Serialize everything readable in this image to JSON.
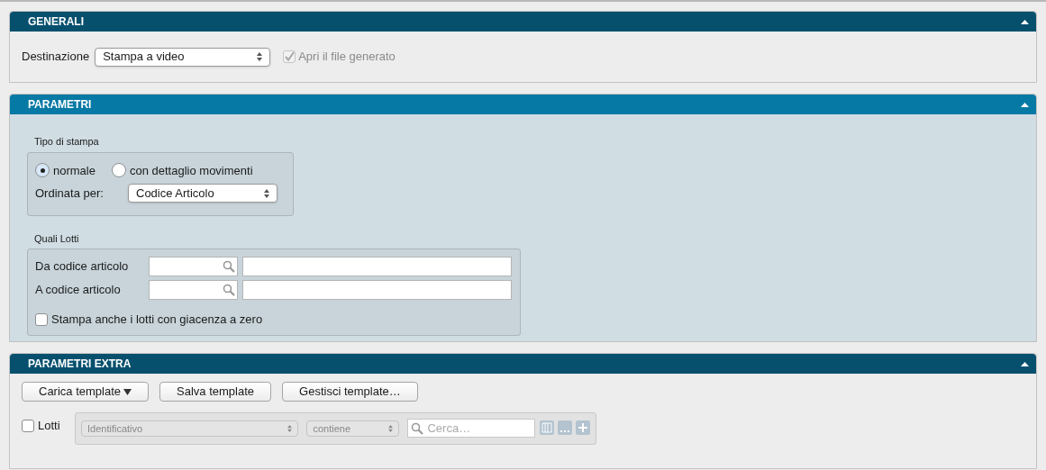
{
  "panels": [
    {
      "kind": "generali",
      "title": "GENERALI",
      "active": false,
      "destination": {
        "label": "Destinazione",
        "value": "Stampa a video"
      },
      "open_file": {
        "label": "Apri il file generato",
        "checked": true,
        "disabled": true
      }
    },
    {
      "kind": "parametri",
      "title": "PARAMETRI",
      "active": true,
      "print_type": {
        "title": "Tipo di stampa",
        "options": [
          {
            "label": "normale",
            "selected": true
          },
          {
            "label": "con dettaglio movimenti",
            "selected": false
          }
        ],
        "sort": {
          "label": "Ordinata per:",
          "value": "Codice Articolo"
        }
      },
      "lots": {
        "title": "Quali Lotti",
        "rows": [
          {
            "label": "Da codice articolo"
          },
          {
            "label": "A codice articolo"
          }
        ],
        "zero_stock": {
          "label": "Stampa anche i lotti con giacenza a zero",
          "checked": false
        }
      }
    },
    {
      "kind": "extra",
      "title": "PARAMETRI EXTRA",
      "active": false,
      "buttons": [
        {
          "label": "Carica template",
          "dropdown": true
        },
        {
          "label": "Salva template",
          "dropdown": false
        },
        {
          "label": "Gestisci template…",
          "dropdown": false
        }
      ],
      "filter": {
        "label": "Lotti",
        "checked": false,
        "field": "Identificativo",
        "operator": "contiene",
        "search_placeholder": "Cerca…"
      }
    }
  ]
}
